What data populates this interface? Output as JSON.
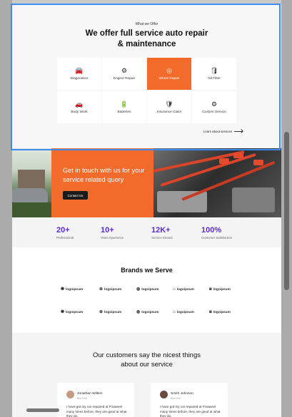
{
  "offer": {
    "kicker": "What we Offer",
    "title_line1": "We offer full service auto repair",
    "title_line2": "& maintenance",
    "services": [
      {
        "label": "Diagnostics",
        "icon": "car-diagnostics-icon",
        "glyph": "🚘"
      },
      {
        "label": "Engine Repair",
        "icon": "engine-icon",
        "glyph": "⚙"
      },
      {
        "label": "Wheel Repair",
        "icon": "wheel-icon",
        "glyph": "◎"
      },
      {
        "label": "Oil Filter",
        "icon": "oil-can-icon",
        "glyph": "🛢"
      },
      {
        "label": "Body Work",
        "icon": "car-body-icon",
        "glyph": "🚗"
      },
      {
        "label": "Batteries",
        "icon": "battery-icon",
        "glyph": "🔋"
      },
      {
        "label": "Insurance Claim",
        "icon": "shield-icon",
        "glyph": "🛡"
      },
      {
        "label": "Custom Service",
        "icon": "gear-icon",
        "glyph": "⚙"
      }
    ],
    "learn_more": "Learn about services"
  },
  "contact": {
    "title": "Get in touch with us for your service related query",
    "button": "Contact Us"
  },
  "stats": [
    {
      "value": "20+",
      "caption": "Professional"
    },
    {
      "value": "10+",
      "caption": "Years Eperience"
    },
    {
      "value": "12K+",
      "caption": "Service Closed"
    },
    {
      "value": "100%",
      "caption": "Customer Satisfaction"
    }
  ],
  "brands": {
    "title": "Brands we Serve",
    "logos": [
      {
        "text": "logoipsum",
        "mark": "✺"
      },
      {
        "text": "logoipsum",
        "mark": "⊕"
      },
      {
        "text": "logoipsum",
        "mark": "◍"
      },
      {
        "text": "logoipsum",
        "mark": "⌂"
      },
      {
        "text": "logoipsum",
        "mark": "◙"
      },
      {
        "text": "logoipsum",
        "mark": "✺"
      },
      {
        "text": "logoipsum",
        "mark": "⊕"
      },
      {
        "text": "logoipsum",
        "mark": "◍"
      },
      {
        "text": "logoipsum",
        "mark": "⌂"
      },
      {
        "text": "logoipsum",
        "mark": "◙"
      }
    ]
  },
  "testimonials": {
    "title_line1": "Our customers say the nicest things",
    "title_line2": "about our service",
    "items": [
      {
        "name": "Jonathan Willem",
        "role": "Bus Unit",
        "quote": "I have got my car repaired at Finaweel many times before, they are good at what they do."
      },
      {
        "name": "Smith Johnson",
        "role": "Bus Unit",
        "quote": "I have got my car repaired at Finaweel many times before, they are good at what they do."
      }
    ]
  },
  "colors": {
    "accent": "#f26b2a",
    "stat": "#5b2bd6",
    "selection": "#3b8ef0"
  }
}
